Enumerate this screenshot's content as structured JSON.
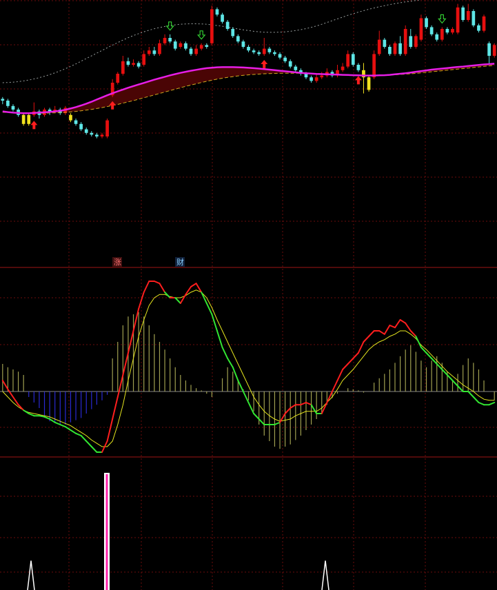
{
  "colors": {
    "background": "#000000",
    "grid": "#6e0d0d",
    "separator": "#a01414",
    "up": "#e60f0f",
    "down": "#5ee6e6",
    "highlight": "#f0e11e",
    "ma_fast": "#e61ee6",
    "ma_slow": "#d2aa1e",
    "band_fill": "#4a0505",
    "envelope": "#9aa0a0",
    "buy_arrow": "#ff1e1e",
    "sell_arrow": "#33cc33",
    "macd_pos": "#a0a050",
    "macd_neg": "#2a2ad2",
    "dif_up": "#ff1e1e",
    "dif_down": "#32e632",
    "dea": "#e6e61e",
    "spike": "#ffffff",
    "spike_core": "#ff1eaa"
  },
  "badges": [
    {
      "text": "涨",
      "color": "#ff7070",
      "bg": "#401010"
    },
    {
      "text": "财",
      "color": "#8ad0ff",
      "bg": "#10203a"
    }
  ],
  "chart_data": [
    {
      "type": "candlestick",
      "panel": "price",
      "ylim": [
        0,
        100
      ],
      "candles": [
        {
          "o": 61,
          "c": 60,
          "h": 62,
          "l": 58
        },
        {
          "o": 60,
          "c": 57,
          "h": 61,
          "l": 56
        },
        {
          "o": 57,
          "c": 55,
          "h": 58,
          "l": 54
        },
        {
          "o": 55,
          "c": 52,
          "h": 56,
          "l": 51
        },
        {
          "o": 52,
          "c": 47,
          "h": 53,
          "l": 46,
          "hl": true
        },
        {
          "o": 47,
          "c": 52,
          "h": 53,
          "l": 46,
          "hl": true
        },
        {
          "o": 52,
          "c": 54,
          "h": 59,
          "l": 51
        },
        {
          "o": 54,
          "c": 52,
          "h": 55,
          "l": 50
        },
        {
          "o": 52,
          "c": 55,
          "h": 56,
          "l": 51
        },
        {
          "o": 55,
          "c": 54,
          "h": 56,
          "l": 52
        },
        {
          "o": 54,
          "c": 55,
          "h": 57,
          "l": 53
        },
        {
          "o": 55,
          "c": 53,
          "h": 56,
          "l": 52
        },
        {
          "o": 53,
          "c": 56,
          "h": 57,
          "l": 52
        },
        {
          "o": 52,
          "c": 49,
          "h": 53,
          "l": 48,
          "hl": true
        },
        {
          "o": 49,
          "c": 47,
          "h": 50,
          "l": 46
        },
        {
          "o": 47,
          "c": 44,
          "h": 48,
          "l": 43
        },
        {
          "o": 44,
          "c": 42,
          "h": 45,
          "l": 41
        },
        {
          "o": 42,
          "c": 41,
          "h": 43,
          "l": 40
        },
        {
          "o": 41,
          "c": 40,
          "h": 42,
          "l": 39
        },
        {
          "o": 40,
          "c": 41,
          "h": 42,
          "l": 39
        },
        {
          "o": 40,
          "c": 49,
          "h": 50,
          "l": 39
        },
        {
          "o": 63,
          "c": 70,
          "h": 72,
          "l": 62
        },
        {
          "o": 70,
          "c": 75,
          "h": 76,
          "l": 69
        },
        {
          "o": 75,
          "c": 82,
          "h": 85,
          "l": 74
        },
        {
          "o": 82,
          "c": 80,
          "h": 84,
          "l": 79
        },
        {
          "o": 80,
          "c": 81,
          "h": 83,
          "l": 79
        },
        {
          "o": 81,
          "c": 79,
          "h": 82,
          "l": 78
        },
        {
          "o": 80,
          "c": 86,
          "h": 88,
          "l": 79
        },
        {
          "o": 86,
          "c": 88,
          "h": 90,
          "l": 85
        },
        {
          "o": 88,
          "c": 86,
          "h": 90,
          "l": 85
        },
        {
          "o": 86,
          "c": 92,
          "h": 94,
          "l": 85
        },
        {
          "o": 92,
          "c": 95,
          "h": 97,
          "l": 91
        },
        {
          "o": 95,
          "c": 93,
          "h": 97,
          "l": 92
        },
        {
          "o": 93,
          "c": 89,
          "h": 94,
          "l": 88
        },
        {
          "o": 90,
          "c": 92,
          "h": 93,
          "l": 89
        },
        {
          "o": 92,
          "c": 89,
          "h": 93,
          "l": 88
        },
        {
          "o": 89,
          "c": 86,
          "h": 90,
          "l": 85
        },
        {
          "o": 86,
          "c": 89,
          "h": 91,
          "l": 85
        },
        {
          "o": 89,
          "c": 91,
          "h": 92,
          "l": 88
        },
        {
          "o": 91,
          "c": 90,
          "h": 92,
          "l": 89
        },
        {
          "o": 92,
          "c": 111,
          "h": 113,
          "l": 91
        },
        {
          "o": 111,
          "c": 108,
          "h": 112,
          "l": 107
        },
        {
          "o": 108,
          "c": 104,
          "h": 109,
          "l": 103
        },
        {
          "o": 104,
          "c": 100,
          "h": 105,
          "l": 99
        },
        {
          "o": 100,
          "c": 96,
          "h": 101,
          "l": 95
        },
        {
          "o": 96,
          "c": 93,
          "h": 97,
          "l": 92
        },
        {
          "o": 93,
          "c": 90,
          "h": 94,
          "l": 89
        },
        {
          "o": 90,
          "c": 88,
          "h": 91,
          "l": 87
        },
        {
          "o": 88,
          "c": 87,
          "h": 89,
          "l": 86
        },
        {
          "o": 87,
          "c": 86,
          "h": 88,
          "l": 85
        },
        {
          "o": 86,
          "c": 89,
          "h": 95,
          "l": 85
        },
        {
          "o": 89,
          "c": 87,
          "h": 90,
          "l": 86
        },
        {
          "o": 87,
          "c": 86,
          "h": 88,
          "l": 85
        },
        {
          "o": 86,
          "c": 84,
          "h": 87,
          "l": 83
        },
        {
          "o": 84,
          "c": 82,
          "h": 85,
          "l": 81
        },
        {
          "o": 82,
          "c": 79,
          "h": 83,
          "l": 78
        },
        {
          "o": 79,
          "c": 77,
          "h": 80,
          "l": 76
        },
        {
          "o": 77,
          "c": 75,
          "h": 78,
          "l": 74
        },
        {
          "o": 75,
          "c": 73,
          "h": 76,
          "l": 72
        },
        {
          "o": 73,
          "c": 71,
          "h": 74,
          "l": 70
        },
        {
          "o": 71,
          "c": 73,
          "h": 75,
          "l": 70
        },
        {
          "o": 73,
          "c": 74,
          "h": 76,
          "l": 72
        },
        {
          "o": 74,
          "c": 76,
          "h": 78,
          "l": 73
        },
        {
          "o": 76,
          "c": 74,
          "h": 77,
          "l": 73
        },
        {
          "o": 74,
          "c": 77,
          "h": 80,
          "l": 73
        },
        {
          "o": 77,
          "c": 79,
          "h": 81,
          "l": 76
        },
        {
          "o": 79,
          "c": 86,
          "h": 88,
          "l": 78
        },
        {
          "o": 86,
          "c": 80,
          "h": 87,
          "l": 79
        },
        {
          "o": 80,
          "c": 77,
          "h": 81,
          "l": 76
        },
        {
          "o": 77,
          "c": 73,
          "h": 81,
          "l": 64,
          "hl": true
        },
        {
          "o": 66,
          "c": 73,
          "h": 74,
          "l": 65,
          "hl": true
        },
        {
          "o": 73,
          "c": 86,
          "h": 88,
          "l": 72
        },
        {
          "o": 86,
          "c": 94,
          "h": 99,
          "l": 85
        },
        {
          "o": 94,
          "c": 90,
          "h": 95,
          "l": 89
        },
        {
          "o": 90,
          "c": 86,
          "h": 91,
          "l": 85
        },
        {
          "o": 86,
          "c": 92,
          "h": 93,
          "l": 85
        },
        {
          "o": 92,
          "c": 86,
          "h": 96,
          "l": 85
        },
        {
          "o": 86,
          "c": 100,
          "h": 102,
          "l": 85
        },
        {
          "o": 96,
          "c": 90,
          "h": 100,
          "l": 89
        },
        {
          "o": 90,
          "c": 96,
          "h": 97,
          "l": 89
        },
        {
          "o": 94,
          "c": 106,
          "h": 108,
          "l": 93
        },
        {
          "o": 106,
          "c": 101,
          "h": 107,
          "l": 100
        },
        {
          "o": 101,
          "c": 97,
          "h": 102,
          "l": 96
        },
        {
          "o": 97,
          "c": 94,
          "h": 98,
          "l": 93
        },
        {
          "o": 94,
          "c": 100,
          "h": 101,
          "l": 93
        },
        {
          "o": 100,
          "c": 98,
          "h": 101,
          "l": 97
        },
        {
          "o": 98,
          "c": 100,
          "h": 101,
          "l": 97
        },
        {
          "o": 98,
          "c": 112,
          "h": 114,
          "l": 97
        },
        {
          "o": 112,
          "c": 105,
          "h": 113,
          "l": 104
        },
        {
          "o": 105,
          "c": 110,
          "h": 114,
          "l": 104
        },
        {
          "o": 110,
          "c": 102,
          "h": 111,
          "l": 101
        },
        {
          "o": 102,
          "c": 99,
          "h": 103,
          "l": 98
        },
        {
          "o": 99,
          "c": 107,
          "h": 108,
          "l": 98
        },
        {
          "o": 92,
          "c": 85,
          "h": 93,
          "l": 80
        },
        {
          "o": 85,
          "c": 91,
          "h": 92,
          "l": 84
        }
      ],
      "ma_fast": [
        54,
        53.6,
        53.3,
        53.1,
        53,
        53,
        53.1,
        53.3,
        53.5,
        53.7,
        54,
        54.4,
        54.9,
        55.6,
        56.4,
        57.3,
        58.3,
        59.4,
        60.6,
        61.8,
        63,
        64.1,
        65.2,
        66.2,
        67.2,
        68.1,
        69,
        69.9,
        70.8,
        71.7,
        72.5,
        73.3,
        74.1,
        74.8,
        75.5,
        76.1,
        76.7,
        77.2,
        77.7,
        78.1,
        78.4,
        78.6,
        78.7,
        78.7,
        78.7,
        78.6,
        78.5,
        78.3,
        78.1,
        77.9,
        77.6,
        77.3,
        77.0,
        76.7,
        76.4,
        76.1,
        75.8,
        75.5,
        75.3,
        75.1,
        74.9,
        74.8,
        74.7,
        74.6,
        74.5,
        74.4,
        74.3,
        74.2,
        74.1,
        74.0,
        74.0,
        74.0,
        74.1,
        74.2,
        74.4,
        74.7,
        75.0,
        75.3,
        75.7,
        76.1,
        76.5,
        76.9,
        77.3,
        77.6,
        77.9,
        78.2,
        78.5,
        78.8,
        79.0,
        79.3,
        79.6,
        79.9,
        80.2,
        80.4,
        80.6
      ],
      "ma_slow": [
        53.5,
        53.4,
        53.3,
        53.2,
        53.1,
        53.0,
        53.0,
        53.0,
        53.0,
        53.1,
        53.2,
        53.3,
        53.5,
        53.7,
        54.0,
        54.3,
        54.7,
        55.1,
        55.6,
        56.1,
        56.7,
        57.3,
        57.9,
        58.6,
        59.3,
        60.0,
        60.8,
        61.6,
        62.4,
        63.2,
        64.0,
        64.8,
        65.6,
        66.4,
        67.2,
        68.0,
        68.7,
        69.4,
        70.1,
        70.8,
        71.4,
        72.0,
        72.5,
        73.0,
        73.4,
        73.8,
        74.1,
        74.4,
        74.6,
        74.8,
        75.0,
        75.1,
        75.2,
        75.3,
        75.3,
        75.3,
        75.3,
        75.3,
        75.2,
        75.2,
        75.1,
        75.0,
        74.9,
        74.8,
        74.7,
        74.6,
        74.5,
        74.4,
        74.3,
        74.2,
        74.1,
        74.1,
        74.1,
        74.2,
        74.3,
        74.4,
        74.6,
        74.8,
        75.0,
        75.2,
        75.5,
        75.8,
        76.1,
        76.4,
        76.7,
        77.0,
        77.3,
        77.6,
        77.9,
        78.2,
        78.5,
        78.8,
        79.1,
        79.4,
        79.7
      ],
      "envelope": [
        70,
        70.1,
        70.3,
        70.6,
        71.0,
        71.5,
        72.1,
        72.8,
        73.6,
        74.5,
        75.5,
        76.6,
        77.8,
        79.1,
        80.5,
        82.0,
        83.5,
        85.0,
        86.5,
        88.0,
        89.5,
        91.0,
        92.4,
        93.8,
        95.1,
        96.3,
        97.4,
        98.4,
        99.3,
        100.1,
        100.8,
        101.4,
        101.9,
        102.3,
        102.6,
        102.8,
        102.9,
        102.9,
        102.8,
        102.6,
        102.3,
        101.9,
        101.5,
        101.0,
        100.5,
        100.0,
        99.5,
        99.1,
        98.7,
        98.4,
        98.2,
        98.1,
        98.1,
        98.2,
        98.4,
        98.7,
        99.1,
        99.6,
        100.2,
        100.9,
        101.7,
        102.6,
        103.6,
        104.6,
        105.6,
        106.6,
        107.6,
        108.5,
        109.4,
        110.2,
        111.0,
        111.7,
        112.4,
        113.0,
        113.6,
        114.1,
        114.6,
        115.1,
        115.5,
        115.9,
        116.3,
        116.6,
        116.9,
        117.2,
        117.5,
        117.8,
        118.0,
        118.2,
        118.4,
        118.6,
        118.8,
        119.0,
        119.2,
        119.3,
        119.4
      ],
      "buy_signals": [
        6,
        21,
        50,
        68
      ],
      "sell_signals": [
        32,
        38,
        84
      ]
    },
    {
      "type": "bar+line",
      "panel": "macd",
      "ylim": [
        -1,
        1
      ],
      "histogram": [
        0.25,
        0.22,
        0.2,
        0.18,
        0.15,
        -0.05,
        -0.1,
        -0.15,
        -0.22,
        -0.27,
        -0.28,
        -0.3,
        -0.3,
        -0.28,
        -0.26,
        -0.24,
        -0.2,
        -0.16,
        -0.12,
        -0.08,
        -0.03,
        0.3,
        0.45,
        0.6,
        0.68,
        0.7,
        0.72,
        0.68,
        0.6,
        0.52,
        0.45,
        0.38,
        0.3,
        0.22,
        0.15,
        0.1,
        0.06,
        0.03,
        0.01,
        -0.02,
        -0.05,
        0.0,
        0.12,
        0.22,
        0.18,
        0.1,
        0.02,
        -0.08,
        -0.18,
        -0.3,
        -0.4,
        -0.45,
        -0.5,
        -0.52,
        -0.5,
        -0.48,
        -0.44,
        -0.4,
        -0.35,
        -0.3,
        -0.25,
        -0.2,
        -0.12,
        -0.06,
        -0.02,
        0.0,
        0.03,
        0.02,
        0.01,
        -0.01,
        0.0,
        0.08,
        0.12,
        0.16,
        0.2,
        0.26,
        0.32,
        0.38,
        0.42,
        0.36,
        0.28,
        0.22,
        0.28,
        0.32,
        0.26,
        0.18,
        0.1,
        0.16,
        0.24,
        0.3,
        0.26,
        0.2,
        0.1,
        0.0,
        -0.08
      ],
      "dif": [
        0.1,
        0.02,
        -0.05,
        -0.12,
        -0.17,
        -0.2,
        -0.22,
        -0.22,
        -0.23,
        -0.25,
        -0.28,
        -0.3,
        -0.32,
        -0.35,
        -0.38,
        -0.4,
        -0.45,
        -0.5,
        -0.55,
        -0.55,
        -0.45,
        -0.25,
        -0.05,
        0.15,
        0.35,
        0.55,
        0.75,
        0.9,
        1.0,
        1.0,
        0.98,
        0.9,
        0.85,
        0.85,
        0.8,
        0.88,
        0.95,
        0.98,
        0.9,
        0.8,
        0.7,
        0.55,
        0.4,
        0.3,
        0.22,
        0.1,
        0.0,
        -0.1,
        -0.2,
        -0.25,
        -0.3,
        -0.3,
        -0.3,
        -0.28,
        -0.2,
        -0.15,
        -0.12,
        -0.12,
        -0.1,
        -0.12,
        -0.2,
        -0.2,
        -0.1,
        0.0,
        0.1,
        0.2,
        0.25,
        0.3,
        0.35,
        0.45,
        0.5,
        0.55,
        0.55,
        0.52,
        0.6,
        0.58,
        0.65,
        0.62,
        0.55,
        0.5,
        0.4,
        0.35,
        0.3,
        0.25,
        0.2,
        0.15,
        0.1,
        0.05,
        0.0,
        0.0,
        -0.05,
        -0.1,
        -0.12,
        -0.12,
        -0.1
      ],
      "dea": [
        0.0,
        -0.05,
        -0.1,
        -0.14,
        -0.17,
        -0.19,
        -0.2,
        -0.21,
        -0.22,
        -0.23,
        -0.25,
        -0.27,
        -0.29,
        -0.31,
        -0.34,
        -0.37,
        -0.4,
        -0.44,
        -0.47,
        -0.5,
        -0.5,
        -0.45,
        -0.3,
        -0.12,
        0.1,
        0.3,
        0.5,
        0.65,
        0.78,
        0.85,
        0.88,
        0.88,
        0.86,
        0.85,
        0.85,
        0.87,
        0.9,
        0.92,
        0.9,
        0.85,
        0.76,
        0.65,
        0.55,
        0.45,
        0.35,
        0.25,
        0.15,
        0.05,
        -0.05,
        -0.12,
        -0.18,
        -0.22,
        -0.25,
        -0.27,
        -0.26,
        -0.25,
        -0.22,
        -0.2,
        -0.18,
        -0.18,
        -0.18,
        -0.15,
        -0.1,
        -0.05,
        0.02,
        0.1,
        0.15,
        0.2,
        0.26,
        0.32,
        0.38,
        0.42,
        0.45,
        0.47,
        0.5,
        0.52,
        0.55,
        0.55,
        0.52,
        0.48,
        0.42,
        0.38,
        0.33,
        0.28,
        0.23,
        0.18,
        0.14,
        0.1,
        0.06,
        0.03,
        0.0,
        -0.04,
        -0.07,
        -0.08,
        -0.08
      ]
    },
    {
      "type": "bar",
      "panel": "signal",
      "ylim": [
        0,
        1
      ],
      "spikes": [
        {
          "x": 45,
          "value": 0.25,
          "style": "thin"
        },
        {
          "x": 155,
          "value": 1.0,
          "style": "thick"
        },
        {
          "x": 472,
          "value": 0.25,
          "style": "thin"
        }
      ]
    }
  ]
}
